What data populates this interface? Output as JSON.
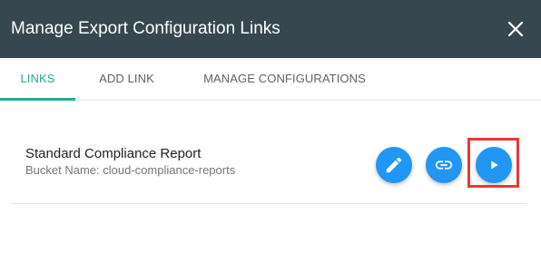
{
  "dialog": {
    "title": "Manage Export Configuration Links",
    "close_icon": "close-icon"
  },
  "tabs": [
    {
      "label": "LINKS",
      "active": true
    },
    {
      "label": "ADD LINK",
      "active": false
    },
    {
      "label": "MANAGE CONFIGURATIONS",
      "active": false
    }
  ],
  "links": [
    {
      "name": "Standard Compliance Report",
      "bucket": "Bucket Name: cloud-compliance-reports",
      "actions": [
        {
          "icon": "pencil-icon",
          "action": "edit"
        },
        {
          "icon": "link-icon",
          "action": "copy-link"
        },
        {
          "icon": "play-icon",
          "action": "run",
          "highlighted": true
        }
      ]
    }
  ],
  "colors": {
    "header_bg": "#37474f",
    "accent": "#26a69a",
    "action_button": "#2196f3",
    "highlight": "#e53935"
  }
}
